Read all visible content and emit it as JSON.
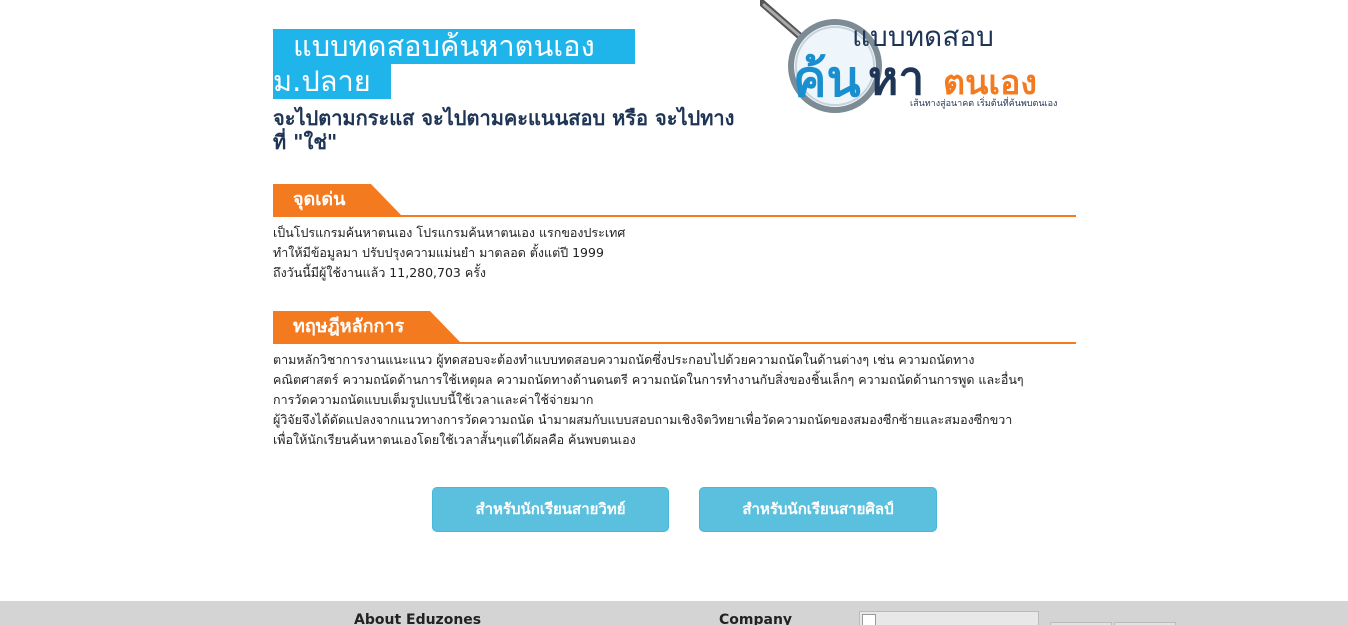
{
  "header": {
    "title_line1": "แบบทดสอบค้นหาตนเอง",
    "title_line2": "ม.ปลาย",
    "subtitle": "จะไปตามกระแส จะไปตามคะแนนสอบ หรือ จะไปทางที่ \"ใช่\""
  },
  "logo": {
    "top_text": "แบบทดสอบ",
    "main_left": "ค้น",
    "main_middle": "หา",
    "main_right": "ตนเอง",
    "tagline": "เส้นทางสู่อนาคต เริ่มต้นที่ค้นพบตนเอง",
    "colors": {
      "blue": "#1a8fd0",
      "orange": "#f47a20",
      "navy": "#1f3556"
    }
  },
  "highlight": {
    "heading": "จุดเด่น",
    "lines": [
      "เป็นโปรแกรมค้นหาตนเอง โปรแกรมค้นหาตนเอง แรกของประเทศ",
      "ทำให้มีข้อมูลมา ปรับปรุงความแม่นยำ มาตลอด ตั้งแต่ปี 1999",
      "ถึงวันนี้มีผู้ใช้งานแล้ว 11,280,703 ครั้ง"
    ]
  },
  "theory": {
    "heading": "ทฤษฎีหลักการ",
    "lines": [
      "ตามหลักวิชาการงานแนะแนว ผู้ทดสอบจะต้องทำแบบทดสอบความถนัดซึ่งประกอบไปด้วยความถนัดในด้านต่างๆ เช่น ความถนัดทาง",
      "คณิตศาสตร์ ความถนัดด้านการใช้เหตุผล ความถนัดทางด้านดนตรี ความถนัดในการทำงานกับสิ่งของชิ้นเล็กๆ ความถนัดด้านการพูด และอื่นๆ",
      "การวัดความถนัดแบบเต็มรูปแบบนี้ใช้เวลาและค่าใช้จ่ายมาก",
      "ผู้วิจัยจึงได้ดัดแปลงจากแนวทางการวัดความถนัด นำมาผสมกับแบบสอบถามเชิงจิตวิทยาเพื่อวัดความถนัดของสมองซีกซ้ายและสมองซีกขวา",
      "เพื่อให้นักเรียนค้นหาตนเองโดยใช้เวลาสั้นๆแต่ได้ผลคือ ค้นพบตนเอง"
    ]
  },
  "buttons": {
    "science": "สำหรับนักเรียนสายวิทย์",
    "arts": "สำหรับนักเรียนสายศิลป์"
  },
  "footer": {
    "about": "About Eduzones",
    "company": "Company"
  },
  "colors": {
    "title_bg": "#1fb4ea",
    "section_accent": "#f47a20",
    "button_bg": "#5bc0de",
    "footer_bg": "#d4d4d4"
  }
}
